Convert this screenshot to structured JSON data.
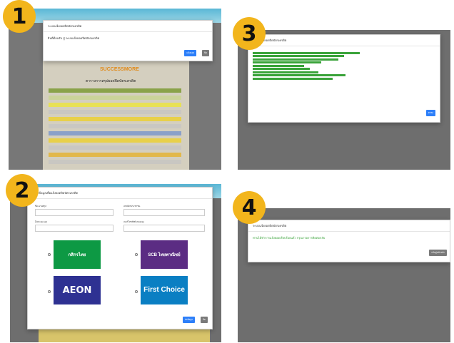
{
  "colors": {
    "badge": "#f2b51c",
    "overlay": "#6e6e6e",
    "primary_button": "#2d7ff9",
    "secondary_button": "#7a7a7a",
    "success_text": "#3aa33a",
    "kbank": "#0d9944",
    "scb": "#5b2c83",
    "aeon": "#2e3192",
    "firstchoice": "#0a7fc3"
  },
  "steps": [
    {
      "number": "1",
      "modal_title": "ระบบแจ้งยอดปิดบัตรเครดิต",
      "modal_body": "ยินดีต้อนรับ สู่ ระบบแจ้งยอดปิดบัตรเครดิต",
      "primary_button": "แจ้งยอด",
      "secondary_button": "ปิด",
      "page_logo": "SUCCESSMORE",
      "page_heading": "ตารางการสรุปยอดปิดบัตรเครดิต"
    },
    {
      "number": "2",
      "modal_title": "กรอกข้อมูลเพื่อแจ้งยอดปิดบัตรเครดิต",
      "labels": [
        "ชื่อ-นามสกุล",
        "เลขบัตรประชาชน",
        "อีเมล (Email)",
        "เบอร์โทรศัพท์ (Mobile)"
      ],
      "banks": [
        "กสิกรไทย",
        "SCB ไทยพาณิชย์",
        "AEON",
        "First Choice"
      ],
      "primary_button": "ส่งข้อมูล",
      "secondary_button": "ปิด"
    },
    {
      "number": "3",
      "modal_title": "ระบบแจ้งยอดปิดบัตรเครดิต",
      "primary_button": "ตกลง"
    },
    {
      "number": "4",
      "modal_title": "ระบบแจ้งยอดปิดบัตรเครดิต",
      "modal_body": "ท่านได้ทำการแจ้งยอดเรียบร้อยแล้ว กรุณารอการติดต่อกลับ",
      "primary_button": "กลับสู่หน้าหลัก"
    }
  ]
}
